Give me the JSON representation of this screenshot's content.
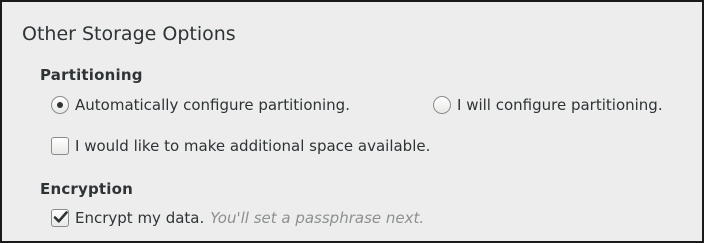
{
  "section": {
    "title": "Other Storage Options"
  },
  "partitioning": {
    "heading": "Partitioning",
    "auto_label": "Automatically configure partitioning.",
    "manual_label": "I will configure partitioning.",
    "auto_selected": true,
    "reclaim_label": "I would like to make additional space available.",
    "reclaim_checked": false
  },
  "encryption": {
    "heading": "Encryption",
    "encrypt_label": "Encrypt my data.",
    "encrypt_hint": "You'll set a passphrase next.",
    "encrypt_checked": true
  },
  "colors": {
    "background": "#ededed",
    "text": "#2e3436",
    "hint": "#8d9091",
    "border": "#8a8f8a"
  },
  "icons": {
    "radio": "radio-button-icon",
    "checkbox": "checkbox-icon",
    "check": "checkmark-icon"
  }
}
